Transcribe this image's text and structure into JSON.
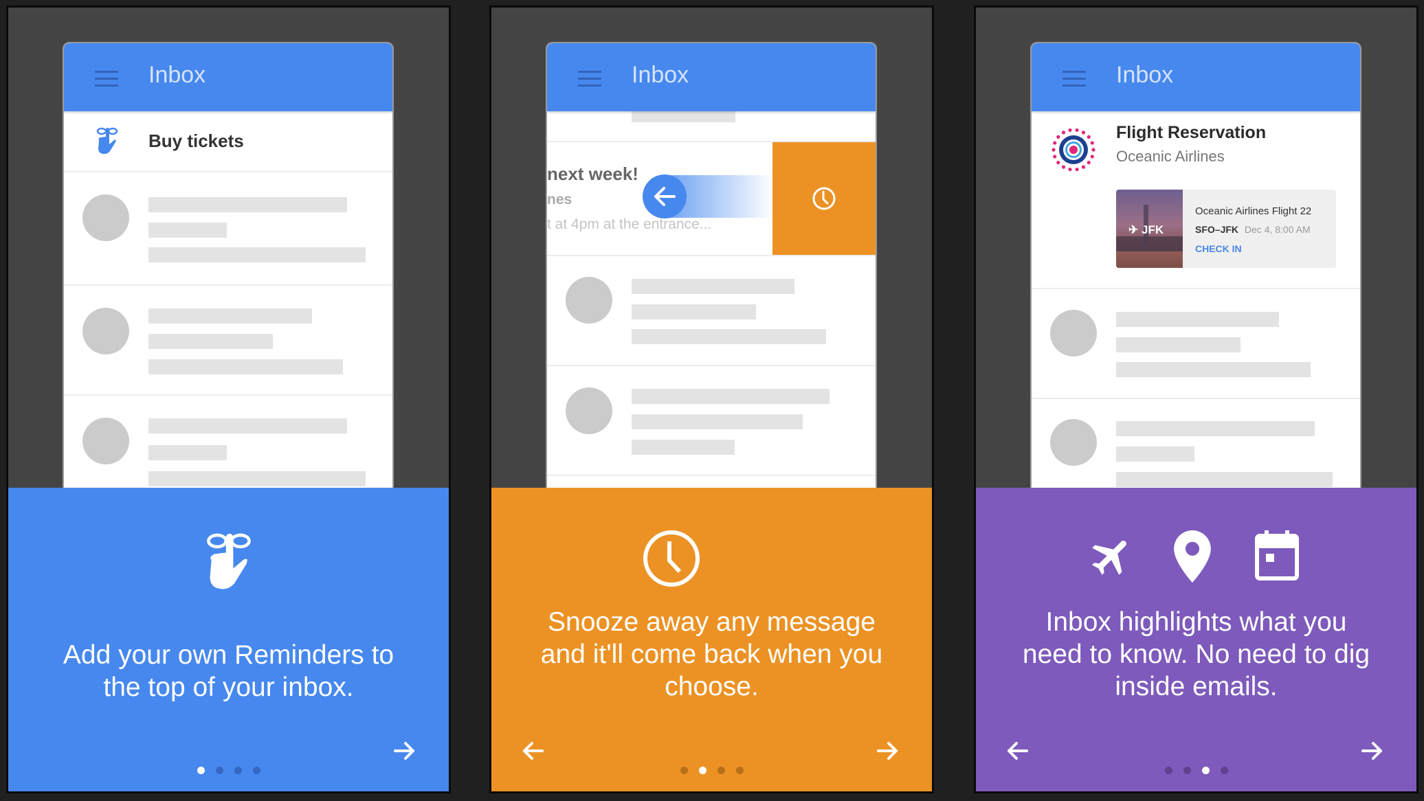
{
  "colors": {
    "page_bg": "#202020",
    "panel_bg": "#444444",
    "app_bar": "#4688ee",
    "reminders_bg": "#4688ee",
    "snooze_bg": "#ec9224",
    "highlights_bg": "#7d5abb",
    "skeleton": "#e3e3e3",
    "avatar": "#cbcbcb",
    "link_blue": "#4a86e8"
  },
  "slides": [
    {
      "app_title": "Inbox",
      "menu_icon": "hamburger-menu-icon",
      "reminder": {
        "icon": "reminder-finger-icon",
        "title": "Buy tickets"
      },
      "feature_icons": [
        "reminder-finger-icon"
      ],
      "caption_lines": [
        "Add your own Reminders to",
        "the top of your inbox."
      ],
      "nav": {
        "prev": null,
        "next": "arrow-forward-icon"
      },
      "page_indicator": {
        "total": 4,
        "active": 1
      }
    },
    {
      "app_title": "Inbox",
      "menu_icon": "hamburger-menu-icon",
      "swiped_email": {
        "subject": "next week!",
        "sender": "nes",
        "snippet": "t at 4pm at the entrance...",
        "swipe_icon": "arrow-back-icon",
        "action_icon": "clock-icon"
      },
      "feature_icons": [
        "clock-icon"
      ],
      "caption_lines": [
        "Snooze away any message",
        "and it'll come back when you",
        "choose."
      ],
      "nav": {
        "prev": "arrow-back-icon",
        "next": "arrow-forward-icon"
      },
      "page_indicator": {
        "total": 4,
        "active": 2
      }
    },
    {
      "app_title": "Inbox",
      "menu_icon": "hamburger-menu-icon",
      "flight_card": {
        "title": "Flight Reservation",
        "sender": "Oceanic Airlines",
        "logo_icon": "oceanic-airlines-logo",
        "thumbnail_label": "JFK",
        "flight_name": "Oceanic Airlines Flight 22",
        "route": "SFO–JFK",
        "datetime": "Dec 4, 8:00 AM",
        "action": "CHECK IN"
      },
      "feature_icons": [
        "airplane-icon",
        "location-pin-icon",
        "calendar-icon"
      ],
      "caption_lines": [
        "Inbox highlights what you",
        "need to know. No need to dig",
        "inside emails."
      ],
      "nav": {
        "prev": "arrow-back-icon",
        "next": "arrow-forward-icon"
      },
      "page_indicator": {
        "total": 4,
        "active": 3
      }
    }
  ]
}
